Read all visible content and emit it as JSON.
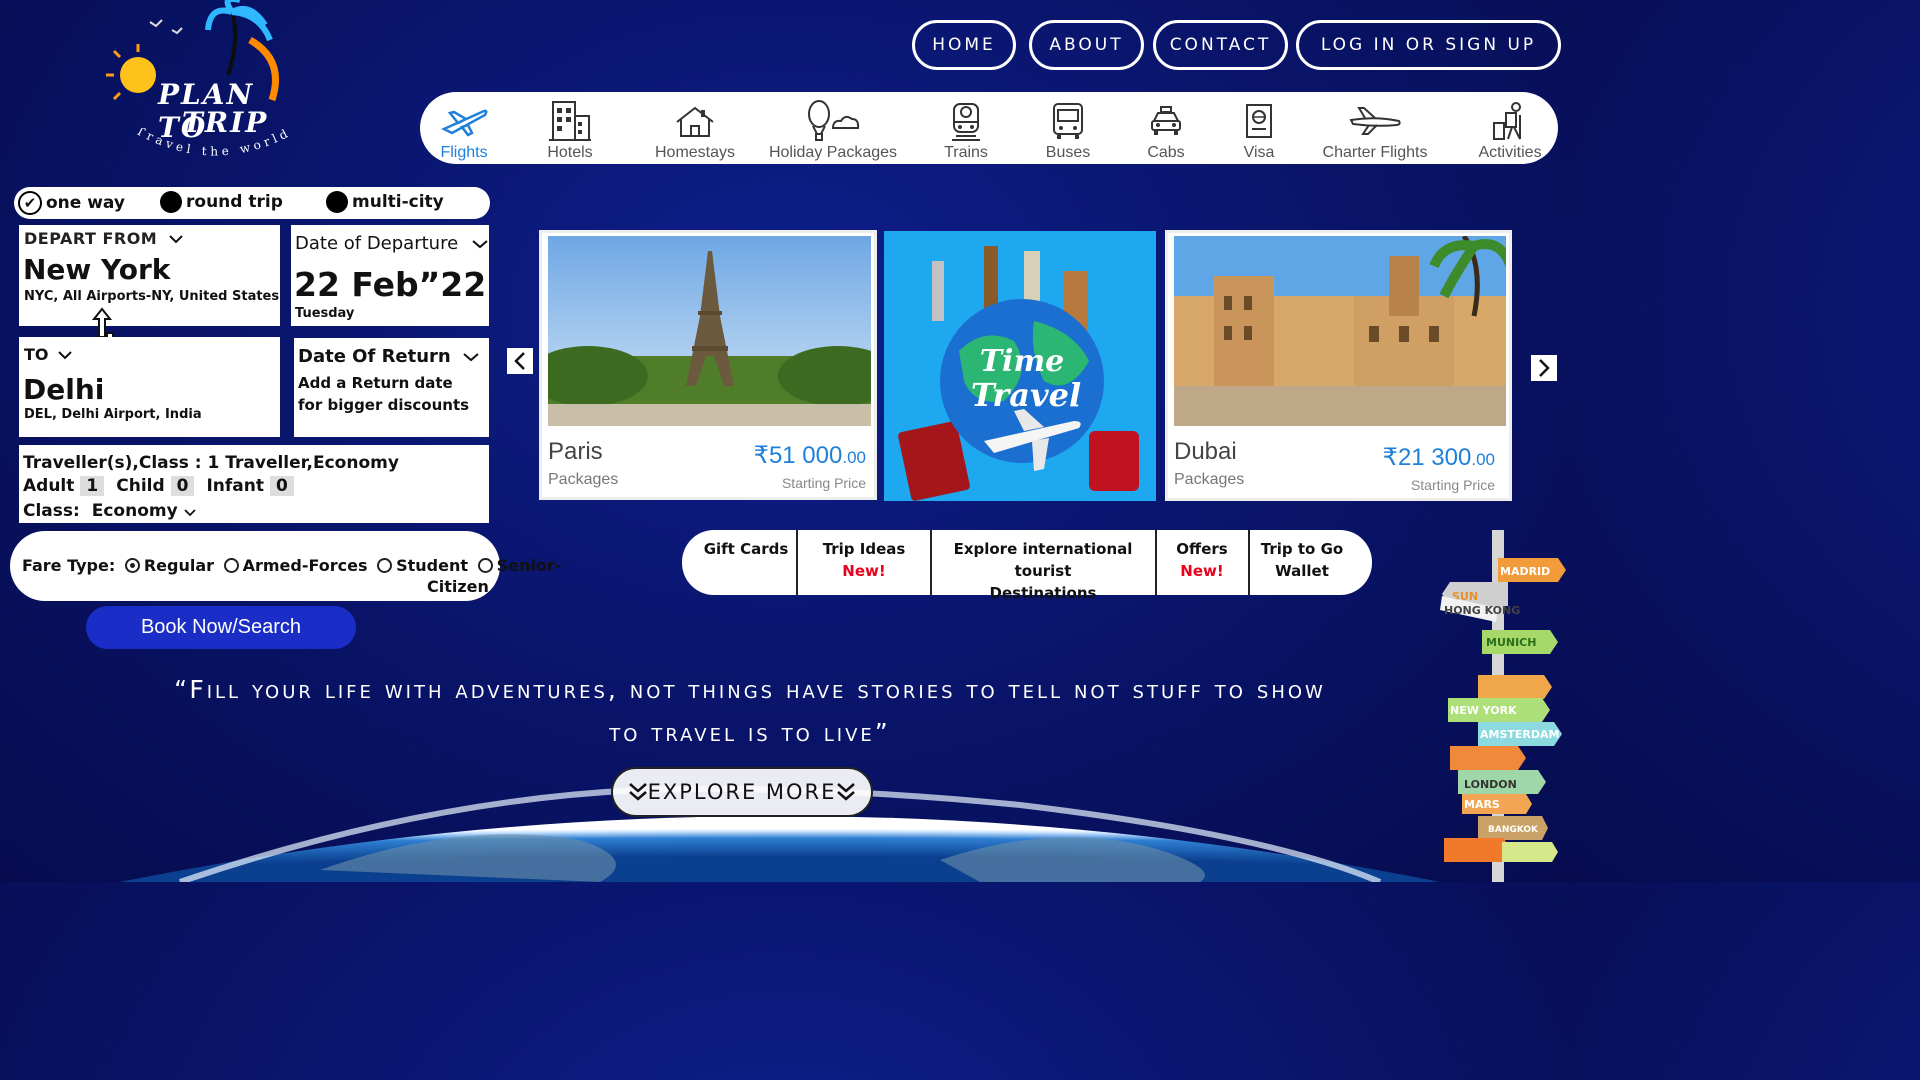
{
  "logo": {
    "line1": "PLAN TO",
    "line2": "TRIP",
    "tagline": "Travel the world"
  },
  "nav": {
    "home": "HOME",
    "about": "ABOUT",
    "contact": "CONTACT",
    "login": "LOG IN OR SIGN UP"
  },
  "categories": [
    "Flights",
    "Hotels",
    "Homestays",
    "Holiday Packages",
    "Trains",
    "Buses",
    "Cabs",
    "Visa",
    "Charter Flights",
    "Activities"
  ],
  "trip_type": {
    "one_way": "one way",
    "round_trip": "round trip",
    "multi_city": "multi-city"
  },
  "depart": {
    "label": "DEPART FROM",
    "city": "New York",
    "detail": "NYC, All Airports-NY, United States"
  },
  "to": {
    "label": "TO",
    "city": "Delhi",
    "detail": "DEL, Delhi Airport, India"
  },
  "departure": {
    "label": "Date of Departure",
    "date": "22 Feb”22",
    "day": "Tuesday"
  },
  "return": {
    "label": "Date Of Return",
    "hint": "Add a Return date for bigger discounts"
  },
  "travellers": {
    "summary": "Traveller(s),Class : 1 Traveller,Economy",
    "adult_label": "Adult",
    "adult": "1",
    "child_label": "Child",
    "child": "0",
    "infant_label": "Infant",
    "infant": "0",
    "class_label": "Class:",
    "class_value": "Economy"
  },
  "fare": {
    "label": "Fare Type:",
    "regular": "Regular",
    "armed": "Armed-Forces",
    "student": "Student",
    "senior": "Senior-",
    "senior2": "Citizen"
  },
  "book_button": "Book Now/Search",
  "packages": [
    {
      "name": "Paris",
      "sub": "Packages",
      "price": "₹51 000",
      "decimals": ".00",
      "note": "Starting Price"
    },
    {
      "name": "Time to Travel"
    },
    {
      "name": "Dubai",
      "sub": "Packages",
      "price": "₹21 300",
      "decimals": ".00",
      "note": "Starting Price"
    }
  ],
  "quick_links": {
    "gift": "Gift Cards",
    "trip_ideas": "Trip Ideas",
    "trip_ideas_badge": "New!",
    "explore1": "Explore international tourist",
    "explore2": "Destinations",
    "offers": "Offers",
    "offers_badge": "New!",
    "wallet1": "Trip to Go",
    "wallet2": "Wallet"
  },
  "quote": {
    "line1": "“Fill your life with adventures, not things have stories to tell not stuff to show",
    "line2": "to travel is to live”"
  },
  "explore_button": "EXPLORE MORE",
  "signpost": [
    "MADRID",
    "SUN",
    "HONG KONG",
    "MUNICH",
    "NEW YORK",
    "AMSTERDAM",
    "LONDON",
    "MARS",
    "BANGKOK"
  ],
  "colors": {
    "background": "#0a1670",
    "accent": "#1f7fd9",
    "book_button": "#1a2ec7",
    "badge": "#e8001c"
  }
}
